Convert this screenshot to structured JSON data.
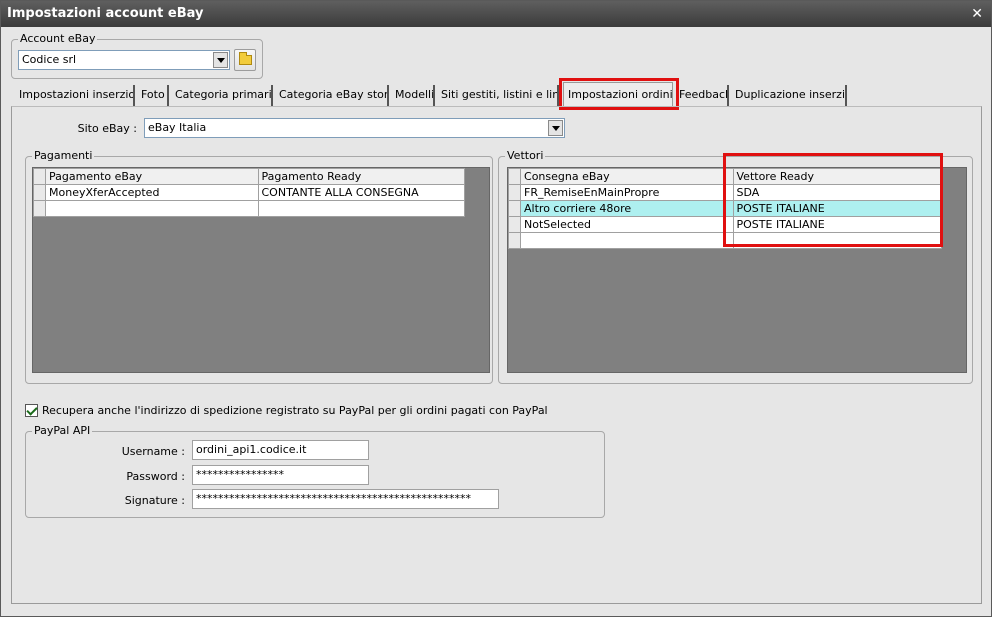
{
  "window": {
    "title": "Impostazioni account eBay",
    "close_glyph": "✕"
  },
  "account": {
    "legend": "Account eBay",
    "selected": "Codice srl"
  },
  "tabs": [
    {
      "label": "Impostazioni inserzioni"
    },
    {
      "label": "Foto"
    },
    {
      "label": "Categoria primaria"
    },
    {
      "label": "Categoria eBay store"
    },
    {
      "label": "Modelli"
    },
    {
      "label": "Siti gestiti, listini e lingue"
    },
    {
      "label": "Impostazioni ordini"
    },
    {
      "label": "Feedback"
    },
    {
      "label": "Duplicazione inserzioni"
    }
  ],
  "site": {
    "label": "Sito eBay :",
    "value": "eBay Italia"
  },
  "payments": {
    "legend": "Pagamenti",
    "columns": [
      "Pagamento eBay",
      "Pagamento Ready"
    ],
    "rows": [
      [
        "MoneyXferAccepted",
        "CONTANTE ALLA CONSEGNA"
      ]
    ]
  },
  "carriers": {
    "legend": "Vettori",
    "columns": [
      "Consegna eBay",
      "Vettore Ready"
    ],
    "rows": [
      [
        "FR_RemiseEnMainPropre",
        "SDA"
      ],
      [
        "Altro corriere 48ore",
        "POSTE ITALIANE"
      ],
      [
        "NotSelected",
        "POSTE ITALIANE"
      ]
    ]
  },
  "paypal_checkbox": {
    "label": "Recupera anche l'indirizzo di spedizione registrato su PayPal per gli ordini pagati con PayPal",
    "checked": true
  },
  "paypal_api": {
    "legend": "PayPal API",
    "username_label": "Username :",
    "username_value": "ordini_api1.codice.it",
    "password_label": "Password :",
    "password_value": "****************",
    "signature_label": "Signature :",
    "signature_value": "**************************************************"
  },
  "colors": {
    "highlight": "#e01010",
    "selected_row": "#aef0f0",
    "grid_bg": "#808080"
  }
}
